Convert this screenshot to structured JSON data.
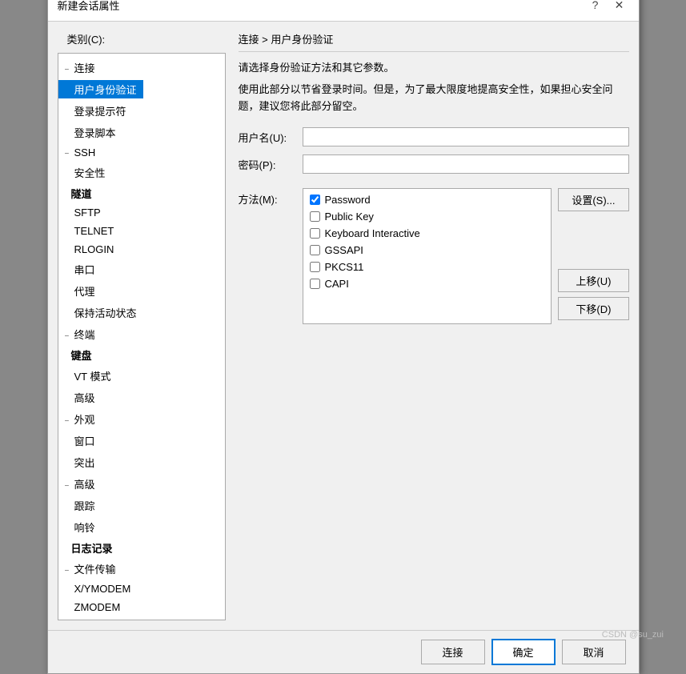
{
  "dialog": {
    "title": "新建会话属性",
    "help_btn": "?",
    "close_btn": "✕"
  },
  "category_label": "类别(C):",
  "tree": {
    "items": [
      {
        "id": "connection",
        "label": "连接",
        "indent": "indent1",
        "expander": "−",
        "selected": false
      },
      {
        "id": "user-auth",
        "label": "用户身份验证",
        "indent": "indent2",
        "expander": "",
        "selected": true
      },
      {
        "id": "login-prompt",
        "label": "登录提示符",
        "indent": "indent3",
        "expander": "",
        "selected": false
      },
      {
        "id": "login-script",
        "label": "登录脚本",
        "indent": "indent3",
        "expander": "",
        "selected": false
      },
      {
        "id": "ssh",
        "label": "SSH",
        "indent": "indent2",
        "expander": "−",
        "selected": false
      },
      {
        "id": "security",
        "label": "安全性",
        "indent": "indent3",
        "expander": "",
        "selected": false
      },
      {
        "id": "tunnel",
        "label": "隧道",
        "indent": "indent3",
        "expander": "",
        "selected": false,
        "bold": true
      },
      {
        "id": "sftp",
        "label": "SFTP",
        "indent": "indent3",
        "expander": "",
        "selected": false
      },
      {
        "id": "telnet",
        "label": "TELNET",
        "indent": "indent2",
        "expander": "",
        "selected": false
      },
      {
        "id": "rlogin",
        "label": "RLOGIN",
        "indent": "indent2",
        "expander": "",
        "selected": false
      },
      {
        "id": "serial",
        "label": "串口",
        "indent": "indent2",
        "expander": "",
        "selected": false
      },
      {
        "id": "proxy",
        "label": "代理",
        "indent": "indent2",
        "expander": "",
        "selected": false
      },
      {
        "id": "keepalive",
        "label": "保持活动状态",
        "indent": "indent2",
        "expander": "",
        "selected": false
      },
      {
        "id": "terminal",
        "label": "终端",
        "indent": "indent1",
        "expander": "−",
        "selected": false
      },
      {
        "id": "keyboard",
        "label": "键盘",
        "indent": "indent2",
        "expander": "",
        "selected": false,
        "bold": true
      },
      {
        "id": "vt-mode",
        "label": "VT 模式",
        "indent": "indent2",
        "expander": "",
        "selected": false
      },
      {
        "id": "advanced",
        "label": "高级",
        "indent": "indent2",
        "expander": "",
        "selected": false
      },
      {
        "id": "appearance",
        "label": "外观",
        "indent": "indent1",
        "expander": "−",
        "selected": false
      },
      {
        "id": "window",
        "label": "窗口",
        "indent": "indent2",
        "expander": "",
        "selected": false
      },
      {
        "id": "highlight",
        "label": "突出",
        "indent": "indent2",
        "expander": "",
        "selected": false
      },
      {
        "id": "advanced2",
        "label": "高级",
        "indent": "indent1",
        "expander": "−",
        "selected": false
      },
      {
        "id": "trace",
        "label": "跟踪",
        "indent": "indent2",
        "expander": "",
        "selected": false
      },
      {
        "id": "bell",
        "label": "响铃",
        "indent": "indent2",
        "expander": "",
        "selected": false
      },
      {
        "id": "log",
        "label": "日志记录",
        "indent": "indent2",
        "expander": "",
        "selected": false,
        "bold": true
      },
      {
        "id": "file-transfer",
        "label": "文件传输",
        "indent": "indent1",
        "expander": "−",
        "selected": false
      },
      {
        "id": "xymodem",
        "label": "X/YMODEM",
        "indent": "indent2",
        "expander": "",
        "selected": false
      },
      {
        "id": "zmodem",
        "label": "ZMODEM",
        "indent": "indent2",
        "expander": "",
        "selected": false
      }
    ]
  },
  "content": {
    "breadcrumb": "连接 > 用户身份验证",
    "desc1": "请选择身份验证方法和其它参数。",
    "desc2": "使用此部分以节省登录时间。但是，为了最大限度地提高安全性，如果担心安全问题，建议您将此部分留空。",
    "username_label": "用户名(U):",
    "password_label": "密码(P):",
    "method_label": "方法(M):",
    "methods": [
      {
        "id": "password",
        "label": "Password",
        "checked": true
      },
      {
        "id": "public-key",
        "label": "Public Key",
        "checked": false
      },
      {
        "id": "keyboard-interactive",
        "label": "Keyboard Interactive",
        "checked": false
      },
      {
        "id": "gssapi",
        "label": "GSSAPI",
        "checked": false
      },
      {
        "id": "pkcs11",
        "label": "PKCS11",
        "checked": false
      },
      {
        "id": "capi",
        "label": "CAPI",
        "checked": false
      }
    ],
    "settings_btn": "设置(S)...",
    "up_btn": "上移(U)",
    "down_btn": "下移(D)"
  },
  "footer": {
    "connect_btn": "连接",
    "ok_btn": "确定",
    "cancel_btn": "取消"
  },
  "watermark": "CSDN @su_zui"
}
